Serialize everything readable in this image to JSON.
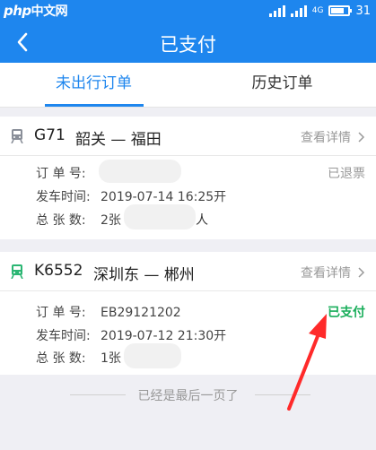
{
  "status_bar": {
    "watermark": "php",
    "watermark_cn": "中文网",
    "network": "4G",
    "battery": "31"
  },
  "nav": {
    "title": "已支付",
    "back_icon": "chevron-left-icon"
  },
  "tabs": [
    {
      "label": "未出行订单",
      "active": true
    },
    {
      "label": "历史订单",
      "active": false
    }
  ],
  "orders": [
    {
      "train_no": "G71",
      "route": "韶关 — 福田",
      "detail_label": "查看详情",
      "icon": "train-icon",
      "icon_color": "#8a8f99",
      "order_label": "订 单 号:",
      "order_value": "",
      "status": "已退票",
      "status_color": "#999999",
      "departure_label": "发车时间:",
      "departure_value": "2019-07-14   16:25开",
      "count_label": "总 张 数:",
      "count_value": "2张",
      "count_suffix": "人"
    },
    {
      "train_no": "K6552",
      "route": "深圳东 — 郴州",
      "detail_label": "查看详情",
      "icon": "train-icon",
      "icon_color": "#2bb673",
      "order_label": "订 单 号:",
      "order_value": "EB29121202",
      "status": "已支付",
      "status_color": "#1aae5b",
      "departure_label": "发车时间:",
      "departure_value": "2019-07-12   21:30开",
      "count_label": "总 张 数:",
      "count_value": "1张",
      "count_suffix": ""
    }
  ],
  "footer_text": "已经是最后一页了",
  "annotation_color": "#ff2a2a"
}
